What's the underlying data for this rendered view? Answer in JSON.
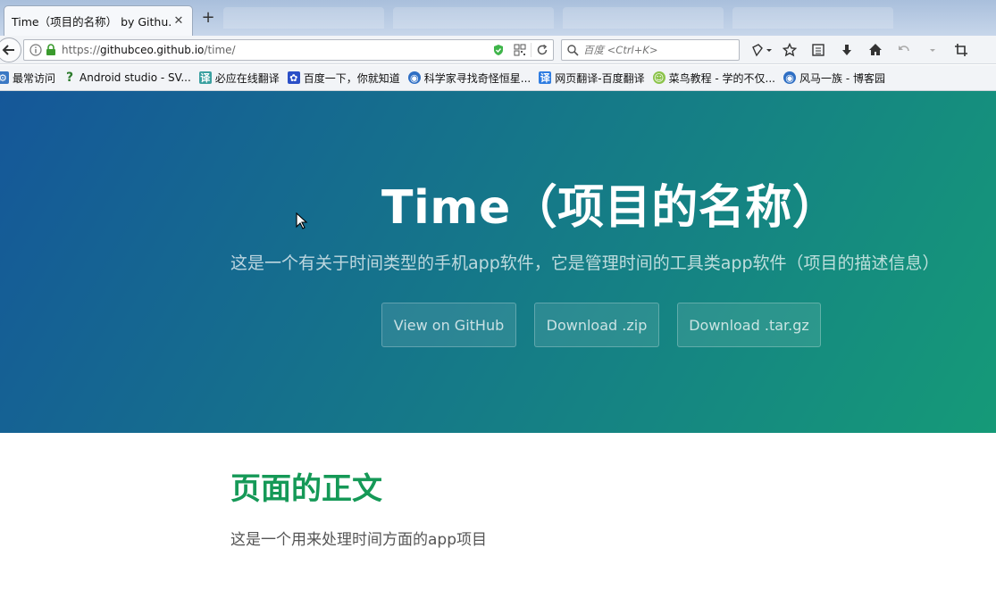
{
  "browser": {
    "tab_title": "Time（项目的名称） by Githu...",
    "tab_close": "✕",
    "new_tab": "+",
    "url": {
      "protocol": "https://",
      "host": "githubceo.github.io",
      "path": "/time/"
    },
    "search_placeholder": "百度 <Ctrl+K>",
    "bookmarks": [
      {
        "label": "最常访问",
        "icon": "gear-icon",
        "color": "#3a78c4"
      },
      {
        "label": "Android studio - SV...",
        "icon": "question-icon",
        "color": "#2b7a2b"
      },
      {
        "label": "必应在线翻译",
        "icon": "translate-icon",
        "color": "#3aa0a0"
      },
      {
        "label": "百度一下，你就知道",
        "icon": "paw-icon",
        "color": "#2b4fc7"
      },
      {
        "label": "科学家寻找奇怪恒星...",
        "icon": "firefox-icon",
        "color": "#2f6fc4"
      },
      {
        "label": "网页翻译-百度翻译",
        "icon": "yi-icon",
        "color": "#2f7de1"
      },
      {
        "label": "菜鸟教程 - 学的不仅...",
        "icon": "runoob-icon",
        "color": "#8bc34a"
      },
      {
        "label": "风马一族 - 博客园",
        "icon": "firefox-icon",
        "color": "#2f6fc4"
      }
    ]
  },
  "hero": {
    "title": "Time（项目的名称）",
    "tagline": "这是一个有关于时间类型的手机app软件，它是管理时间的工具类app软件（项目的描述信息）",
    "buttons": {
      "github": "View on GitHub",
      "zip": "Download .zip",
      "tar": "Download .tar.gz"
    }
  },
  "main": {
    "heading": "页面的正文",
    "text": "这是一个用来处理时间方面的app项目"
  },
  "colors": {
    "hero_start": "#155799",
    "hero_end": "#159a78",
    "heading": "#159957"
  }
}
